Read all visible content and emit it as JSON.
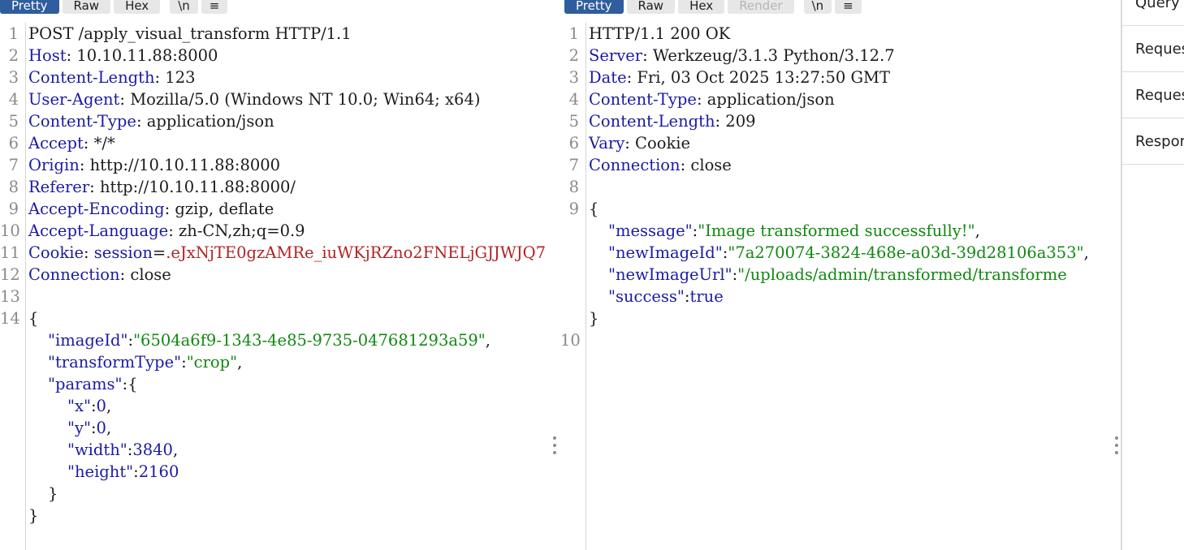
{
  "request_tabs": [
    "Pretty",
    "Raw",
    "Hex",
    "\\n",
    "≡"
  ],
  "response_tabs": [
    "Pretty",
    "Raw",
    "Hex",
    "Render",
    "\\n",
    "≡"
  ],
  "request": {
    "line_numbers": [
      "1",
      "2",
      "3",
      "4",
      "5",
      "6",
      "7",
      "8",
      "9",
      "10",
      "11",
      "12",
      "13",
      "14"
    ],
    "request_line": "POST /apply_visual_transform HTTP/1.1",
    "headers": [
      {
        "name": "Host",
        "value": "10.10.11.88:8000"
      },
      {
        "name": "Content-Length",
        "value": "123"
      },
      {
        "name": "User-Agent",
        "value": "Mozilla/5.0 (Windows NT 10.0; Win64; x64)"
      },
      {
        "name": "Content-Type",
        "value": "application/json"
      },
      {
        "name": "Accept",
        "value": "*/*"
      },
      {
        "name": "Origin",
        "value": "http://10.10.11.88:8000"
      },
      {
        "name": "Referer",
        "value": "http://10.10.11.88:8000/"
      },
      {
        "name": "Accept-Encoding",
        "value": "gzip, deflate"
      },
      {
        "name": "Accept-Language",
        "value": "zh-CN,zh;q=0.9"
      }
    ],
    "cookie": {
      "name": "Cookie",
      "cookie_key": "session",
      "cookie_value": ".eJxNjTE0gzAMRe_iuWKjRZno2FNELjGJJWJQ7"
    },
    "connection": {
      "name": "Connection",
      "value": "close"
    },
    "body": {
      "open": "{",
      "imageId_key": "\"imageId\"",
      "imageId_val": "\"6504a6f9-1343-4e85-9735-047681293a59\"",
      "transformType_key": "\"transformType\"",
      "transformType_val": "\"crop\"",
      "params_key": "\"params\"",
      "x_key": "\"x\"",
      "x_val": "0",
      "y_key": "\"y\"",
      "y_val": "0",
      "width_key": "\"width\"",
      "width_val": "3840",
      "height_key": "\"height\"",
      "height_val": "2160",
      "close_inner": "}",
      "close": "}"
    }
  },
  "response": {
    "line_numbers": [
      "1",
      "2",
      "3",
      "4",
      "5",
      "6",
      "7",
      "8",
      "9",
      "10"
    ],
    "status_line": "HTTP/1.1 200 OK",
    "headers": [
      {
        "name": "Server",
        "value": "Werkzeug/3.1.3 Python/3.12.7"
      },
      {
        "name": "Date",
        "value": "Fri, 03 Oct 2025 13:27:50 GMT"
      },
      {
        "name": "Content-Type",
        "value": "application/json"
      },
      {
        "name": "Content-Length",
        "value": "209"
      },
      {
        "name": "Vary",
        "value": "Cookie"
      },
      {
        "name": "Connection",
        "value": "close"
      }
    ],
    "body": {
      "open": "{",
      "message_key": "\"message\"",
      "message_val": "\"Image transformed successfully!\"",
      "newImageId_key": "\"newImageId\"",
      "newImageId_val": "\"7a270074-3824-468e-a03d-39d28106a353\"",
      "newImageUrl_key": "\"newImageUrl\"",
      "newImageUrl_val": "\"/uploads/admin/transformed/transforme",
      "success_key": "\"success\"",
      "success_val": "true",
      "close": "}"
    }
  },
  "inspector": {
    "items": [
      "Query p",
      "Reques",
      "Reques",
      "Respor"
    ]
  }
}
